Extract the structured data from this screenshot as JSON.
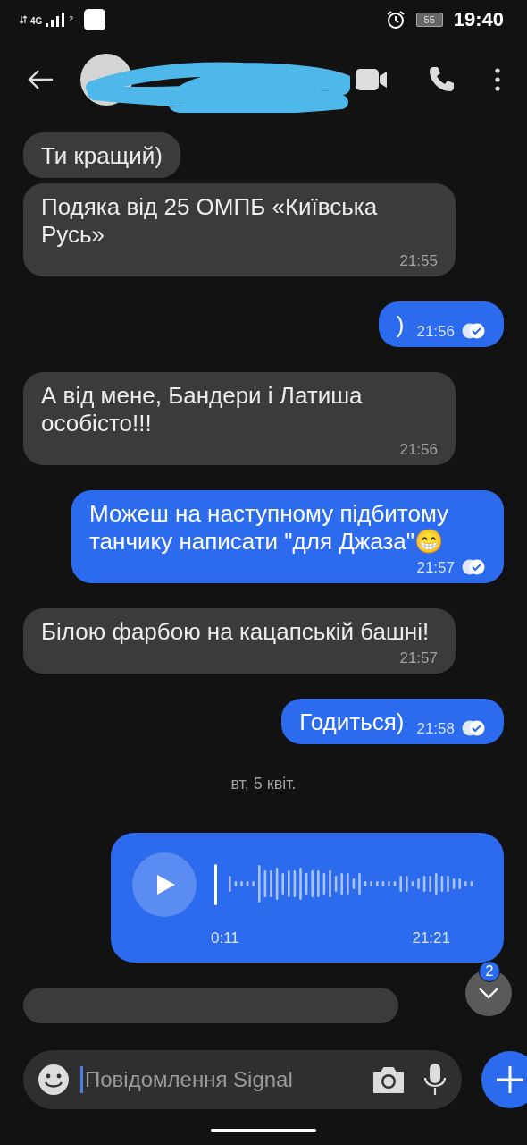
{
  "status_bar": {
    "network": "4G",
    "sim": "2",
    "battery": "55",
    "time": "19:40"
  },
  "messages": [
    {
      "kind": "incoming",
      "text": "Ти кращий)"
    },
    {
      "kind": "incoming",
      "text": "Подяка від 25 ОМПБ «Київська Русь»",
      "time": "21:55"
    },
    {
      "kind": "outgoing",
      "text": ")",
      "time": "21:56",
      "read": true
    },
    {
      "kind": "incoming",
      "text": "А від мене, Бандери і Латиша особісто!!!",
      "time": "21:56"
    },
    {
      "kind": "outgoing",
      "text": "Можеш на наступному підбитому танчику написати \"для Джаза\"😁",
      "time": "21:57",
      "read": true
    },
    {
      "kind": "incoming",
      "text": "Білою фарбою на кацапській башні!",
      "time": "21:57"
    },
    {
      "kind": "outgoing",
      "text": "Годиться)",
      "time": "21:58",
      "read": true
    },
    {
      "kind": "date",
      "text": "вт, 5 квіт."
    },
    {
      "kind": "voice",
      "duration": "0:11",
      "time": "21:21"
    },
    {
      "kind": "incoming_cut"
    }
  ],
  "scroll_button": {
    "badge": "2"
  },
  "composer": {
    "placeholder": "Повідомлення Signal"
  }
}
